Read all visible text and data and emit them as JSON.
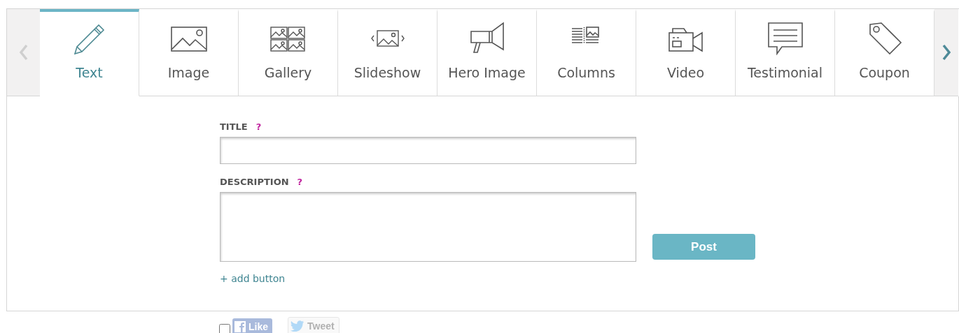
{
  "nav": {
    "prev": {
      "disabled": true
    },
    "next": {
      "disabled": false
    }
  },
  "tabs": [
    {
      "label": "Text",
      "selected": true
    },
    {
      "label": "Image",
      "selected": false
    },
    {
      "label": "Gallery",
      "selected": false
    },
    {
      "label": "Slideshow",
      "selected": false
    },
    {
      "label": "Hero Image",
      "selected": false
    },
    {
      "label": "Columns",
      "selected": false
    },
    {
      "label": "Video",
      "selected": false
    },
    {
      "label": "Testimonial",
      "selected": false
    },
    {
      "label": "Coupon",
      "selected": false
    }
  ],
  "form": {
    "fields": [
      {
        "label": "TITLE",
        "help": "?",
        "kind": "line"
      },
      {
        "label": "DESCRIPTION",
        "help": "?",
        "kind": "area"
      }
    ],
    "add_link": "+ add button",
    "submit": "Post"
  },
  "share": {
    "checked": false,
    "buttons": [
      {
        "kind": "like",
        "label": "Like",
        "disabled": true
      },
      {
        "kind": "tweet",
        "label": "Tweet",
        "disabled": true
      }
    ]
  }
}
